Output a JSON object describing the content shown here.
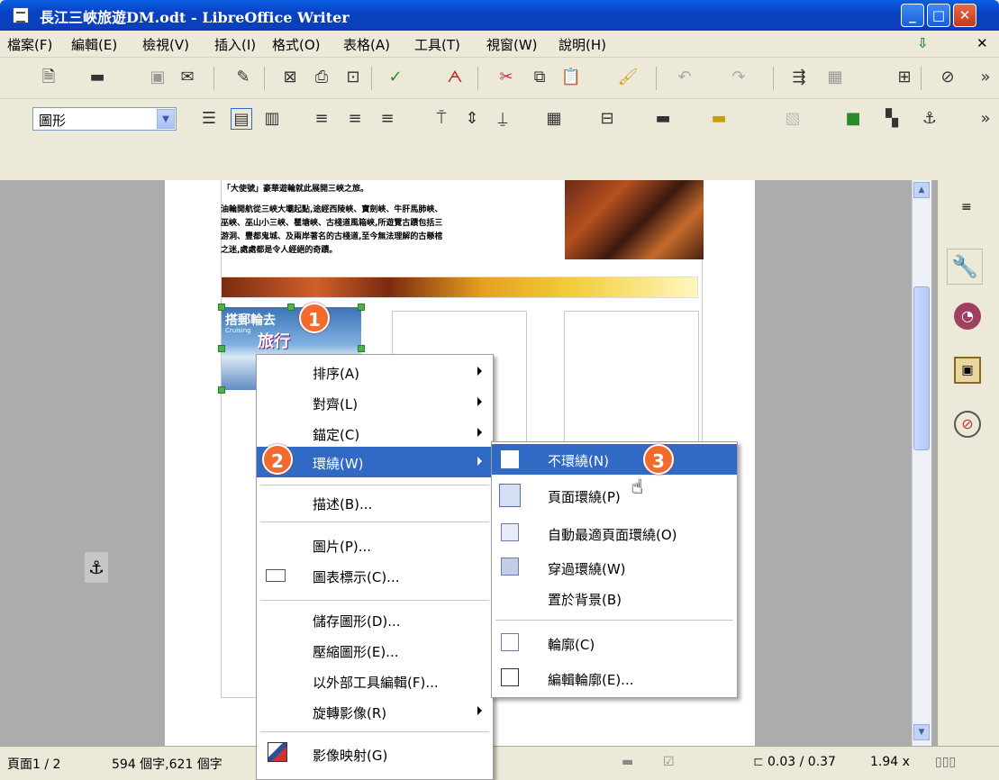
{
  "window": {
    "title": "長江三峽旅遊DM.odt - LibreOffice Writer"
  },
  "menubar": [
    "檔案(F)",
    "編輯(E)",
    "檢視(V)",
    "插入(I)",
    "格式(O)",
    "表格(A)",
    "工具(T)",
    "視窗(W)",
    "說明(H)"
  ],
  "toolbar2": {
    "style_value": "圖形"
  },
  "document": {
    "caption_line": "「大使號」豪華遊輪就此展開三峽之旅。",
    "paragraph": [
      "油輪開航從三峽大壩起點,途經西陵峽、寶劍峽、牛肝馬肺峽、",
      "巫峽、巫山小三峽、瞿塘峽、古棧道風箱峽,所遊覽古蹟包括三",
      "游洞、豐都鬼城、及兩岸著名的古棧道,至今無法理解的古懸棺",
      "之迷,處處都是令人經絕的奇蹟。"
    ],
    "image_text": {
      "line1": "搭郵輪去",
      "line2": "旅行",
      "line3": "Cruising"
    }
  },
  "context_menu": {
    "items": [
      "排序(A)",
      "對齊(L)",
      "錨定(C)",
      "環繞(W)",
      "描述(B)...",
      "圖片(P)...",
      "圖表標示(C)...",
      "儲存圖形(D)...",
      "壓縮圖形(E)...",
      "以外部工具編輯(F)...",
      "旋轉影像(R)",
      "影像映射(G)"
    ]
  },
  "submenu": {
    "items": [
      "不環繞(N)",
      "頁面環繞(P)",
      "自動最適頁面環繞(O)",
      "穿過環繞(W)",
      "置於背景(B)",
      "輪廓(C)",
      "編輯輪廓(E)..."
    ]
  },
  "badges": [
    "1",
    "2",
    "3"
  ],
  "statusbar": {
    "page": "頁面1 / 2",
    "words": "594 個字,621 個字",
    "position": "0.03 / 0.37",
    "size": "1.94 x"
  },
  "colors": {
    "highlight": "#316ac5",
    "badge": "#f26a2c",
    "titlebar": "#0842c2"
  }
}
